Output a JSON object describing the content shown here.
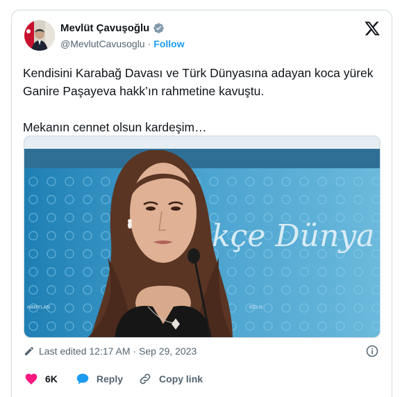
{
  "author": {
    "name": "Mevlüt Çavuşoğlu",
    "handle": "@MevlutCavusoglu",
    "separator": "·",
    "follow_label": "Follow"
  },
  "tweet": {
    "line1": "Kendisini Karabağ Davası ve Türk Dünyasına adayan koca yürek Ganire Paşayeva hakk’ın rahmetine kavuştu.",
    "line2": "Mekanın cennet olsun kardeşim…"
  },
  "media": {
    "banner_text": "kçe Dünya",
    "small_text_left": "HARYLAN",
    "small_text_right": "KÖLN"
  },
  "meta": {
    "edited_label": "Last edited 12:17 AM · Sep 29, 2023"
  },
  "actions": {
    "like_count": "6K",
    "reply_label": "Reply",
    "copy_link_label": "Copy link"
  },
  "colors": {
    "accent": "#1d9bf0",
    "like": "#f91880",
    "text_secondary": "#536471"
  }
}
